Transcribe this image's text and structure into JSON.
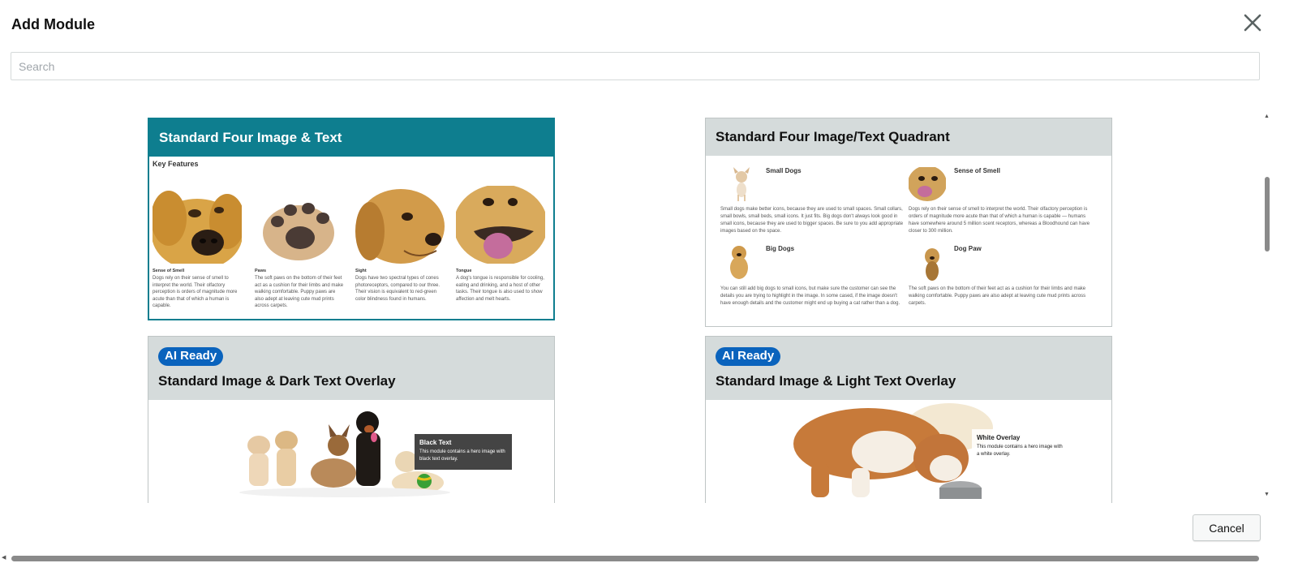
{
  "modal": {
    "title": "Add Module",
    "close_icon": "close-icon",
    "search_placeholder": "Search",
    "search_value": "",
    "cancel_label": "Cancel"
  },
  "colors": {
    "selected_header": "#0e7e8f",
    "card_header": "#d5dbdb",
    "ai_badge": "#0a63bd"
  },
  "cards": [
    {
      "title": "Standard Four Image & Text",
      "selected": true,
      "key_features_label": "Key Features",
      "features": [
        {
          "name": "Sense of Smell",
          "desc": "Dogs rely on their sense of smell to interpret the world. Their olfactory perception is orders of magnitude more acute than that of which a human is capable."
        },
        {
          "name": "Paws",
          "desc": "The soft paws on the bottom of their feet act as a cushion for their limbs and make walking comfortable. Puppy paws are also adept at leaving cute mud prints across carpets."
        },
        {
          "name": "Sight",
          "desc": "Dogs have two spectral types of cones photoreceptors, compared to our three. Their vision is equivalent to red-green color blindness found in humans."
        },
        {
          "name": "Tongue",
          "desc": "A dog's tongue is responsible for cooling, eating and drinking, and a host of other tasks. Their tongue is also used to show affection and melt hearts."
        }
      ]
    },
    {
      "title": "Standard Four Image/Text Quadrant",
      "selected": false,
      "quadrants": [
        {
          "name": "Small Dogs",
          "desc": "Small dogs make better icons, because they are used to small spaces. Small collars, small bowls, small beds, small icons. It just fits. Big dogs don't always look good in small icons, because they are used to bigger spaces. Be sure to you add appropriate images based on the space."
        },
        {
          "name": "Sense of Smell",
          "desc": "Dogs rely on their sense of smell to interpret the world. Their olfactory perception is orders of magnitude more acute than that of which a human is capable — humans have somewhere around 5 million scent receptors, whereas a Bloodhound can have closer to 300 million."
        },
        {
          "name": "Big Dogs",
          "desc": "You can still add big dogs to small icons, but make sure the customer can see the details you are trying to highlight in the image. In some cased, if the image doesn't have enough details and the customer might end up buying a cat rather than a dog."
        },
        {
          "name": "Dog Paw",
          "desc": "The soft paws on the bottom of their feet act as a cushion for their limbs and make walking comfortable. Puppy paws are also adept at leaving cute mud prints across carpets."
        }
      ]
    },
    {
      "title": "Standard Image & Dark Text Overlay",
      "badge": "AI Ready",
      "overlay_title": "Black Text",
      "overlay_text": "This module contains a hero image with black text overlay."
    },
    {
      "title": "Standard Image & Light Text Overlay",
      "badge": "AI Ready",
      "overlay_title": "White Overlay",
      "overlay_text": "This module contains a hero image with a white overlay."
    }
  ]
}
